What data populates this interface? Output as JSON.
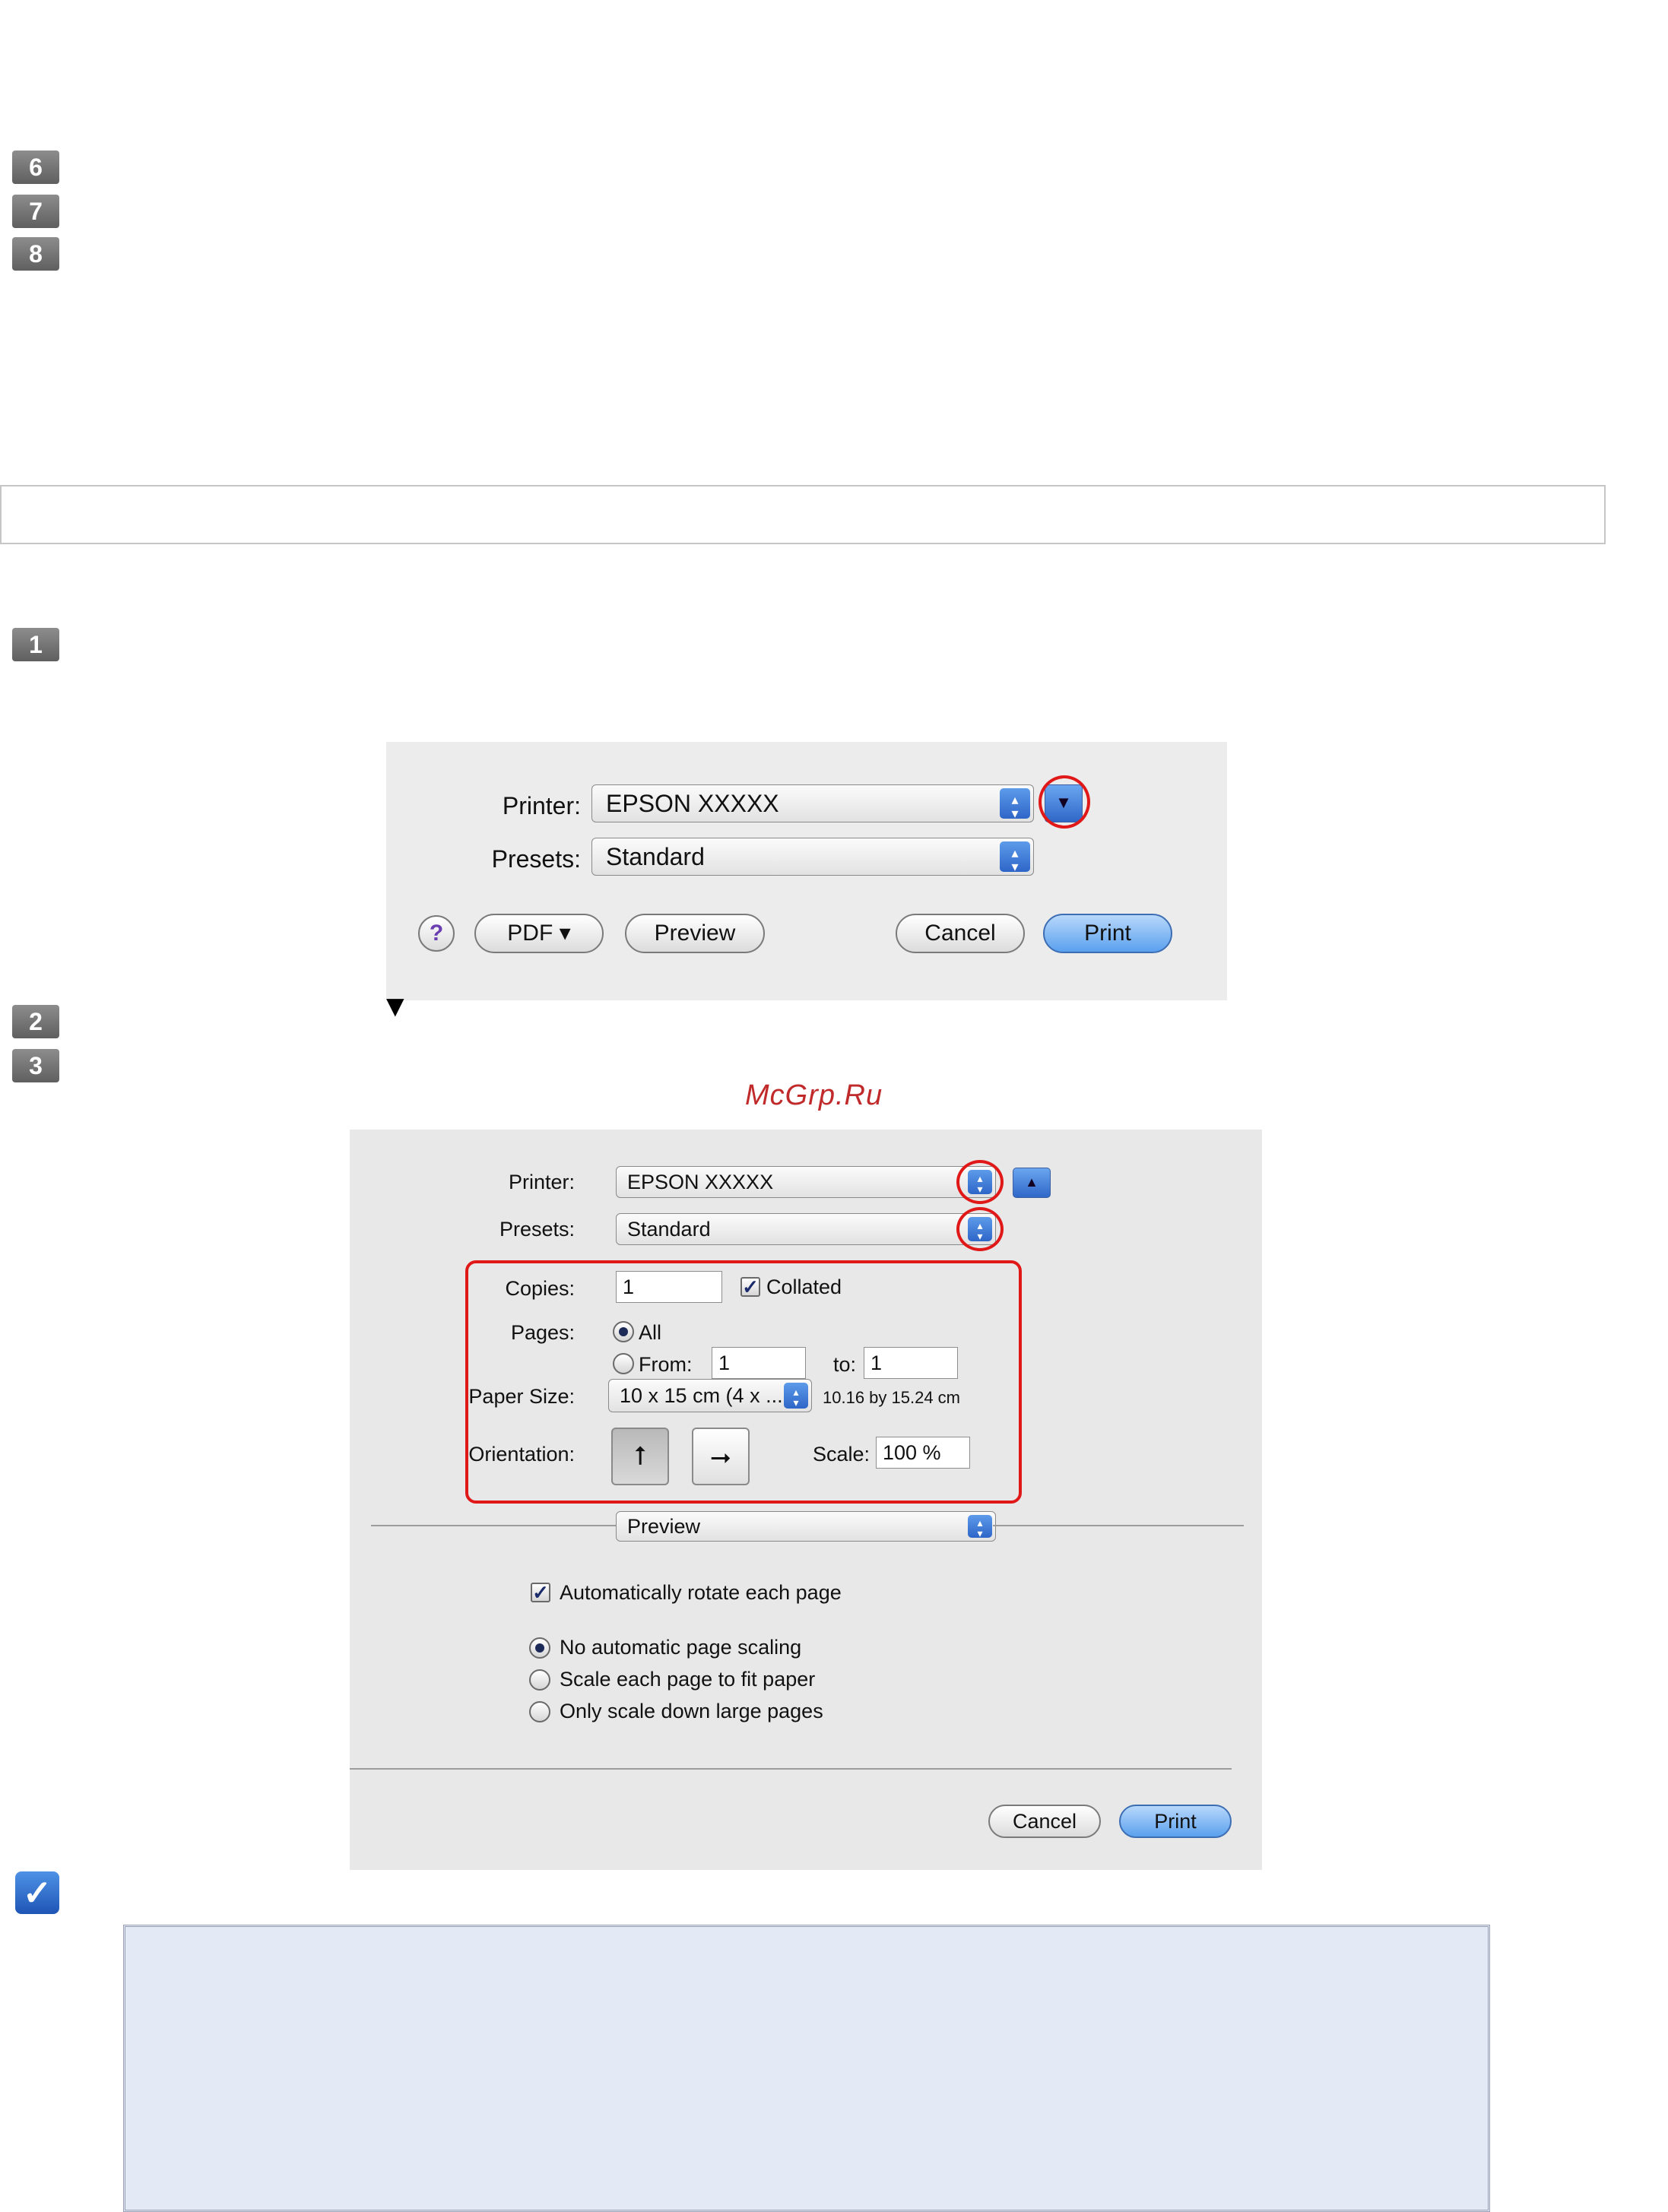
{
  "steps": {
    "s6": "6",
    "s7": "7",
    "s8": "8",
    "s1": "1",
    "s2": "2",
    "s3": "3"
  },
  "arrow_glyph": "▼",
  "watermark": "McGrp.Ru",
  "dialog1": {
    "printer_label": "Printer:",
    "printer_value": "EPSON XXXXX",
    "presets_label": "Presets:",
    "presets_value": "Standard",
    "help_label": "?",
    "pdf_button": "PDF ▾",
    "preview_button": "Preview",
    "cancel_button": "Cancel",
    "print_button": "Print"
  },
  "dialog2": {
    "printer_label": "Printer:",
    "printer_value": "EPSON XXXXX",
    "presets_label": "Presets:",
    "presets_value": "Standard",
    "copies_label": "Copies:",
    "copies_value": "1",
    "collated_label": "Collated",
    "collated_checked": true,
    "pages_label": "Pages:",
    "pages_all_label": "All",
    "pages_from_label": "From:",
    "pages_from_value": "1",
    "pages_to_label": "to:",
    "pages_to_value": "1",
    "paper_size_label": "Paper Size:",
    "paper_size_value": "10 x 15 cm (4 x ...",
    "paper_size_dims": "10.16 by 15.24 cm",
    "orientation_label": "Orientation:",
    "scale_label": "Scale:",
    "scale_value": "100 %",
    "section_value": "Preview",
    "auto_rotate_label": "Automatically rotate each page",
    "auto_rotate_checked": true,
    "scaling_options": [
      "No automatic page scaling",
      "Scale each page to fit paper",
      "Only scale down large pages"
    ],
    "scaling_selected": 0,
    "cancel_button": "Cancel",
    "print_button": "Print"
  },
  "note_icon": "✓",
  "colors": {
    "highlight_red": "#e01818",
    "aqua_blue": "#5aa0ee",
    "note_bg": "#e4e9f6"
  }
}
